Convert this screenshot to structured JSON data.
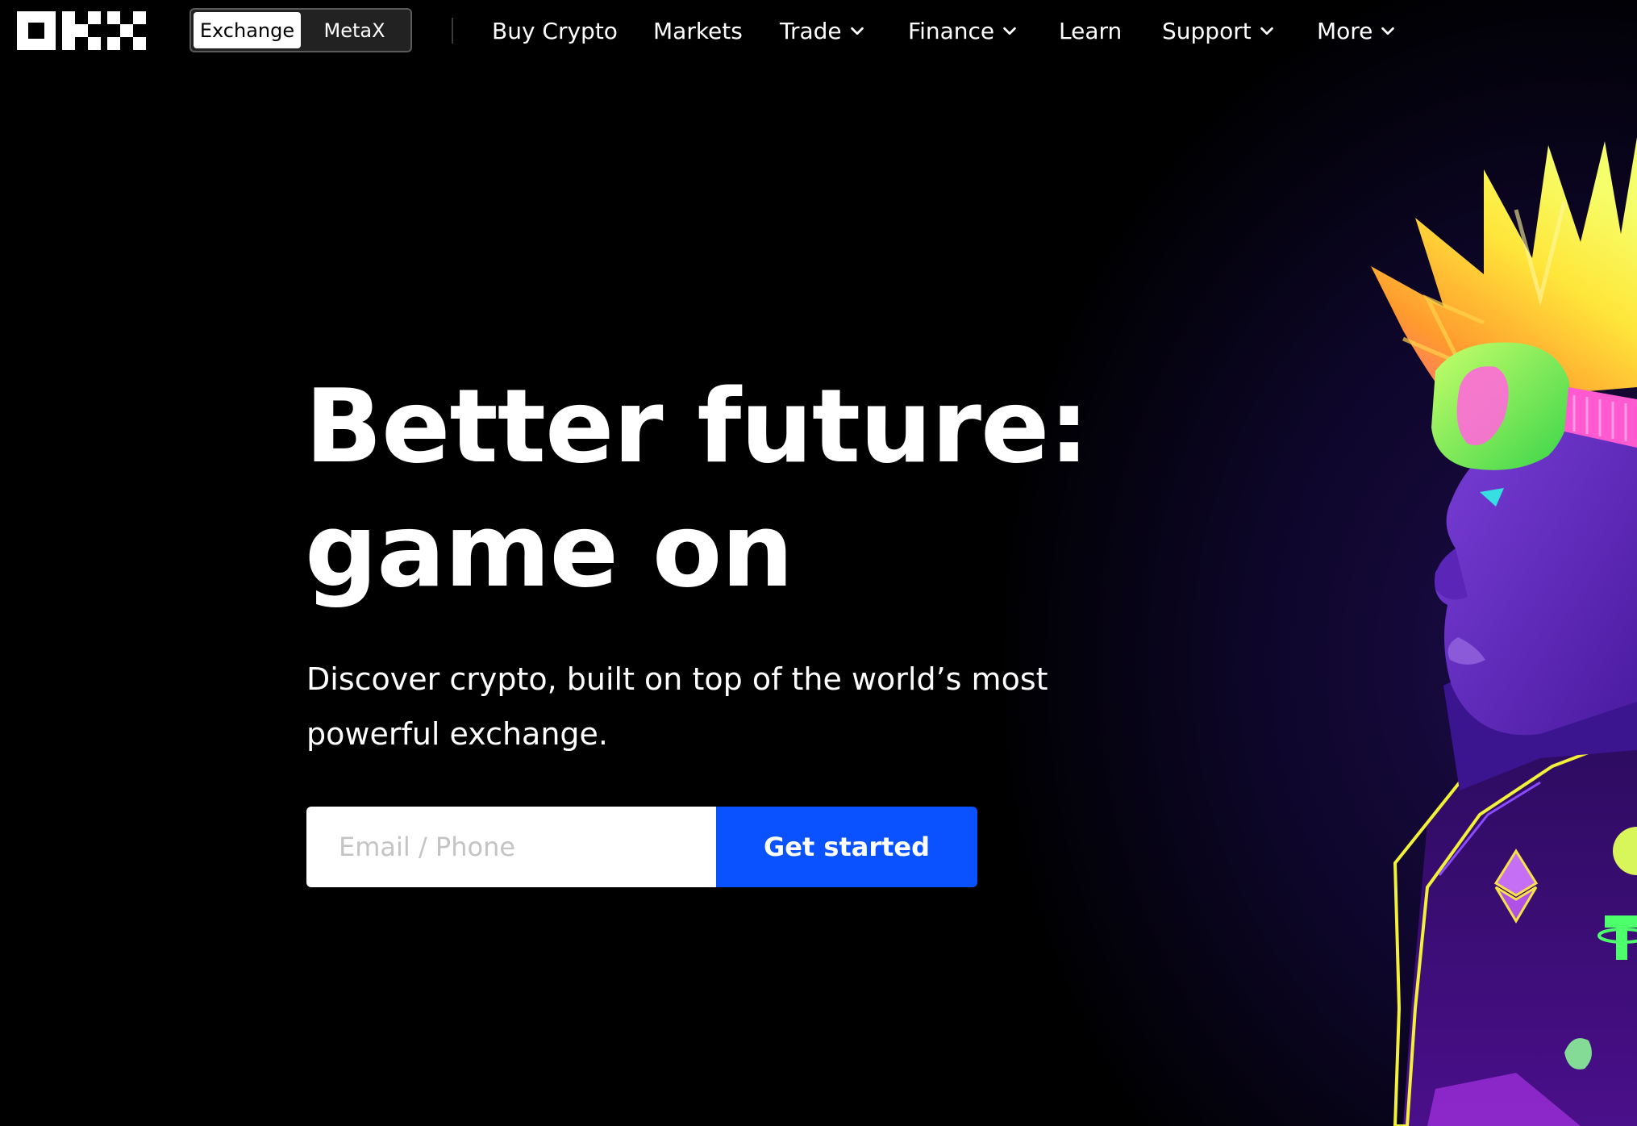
{
  "brand": {
    "logo_text": "OKX"
  },
  "mode_switch": {
    "exchange_label": "Exchange",
    "metax_label": "MetaX",
    "active": "Exchange"
  },
  "nav": {
    "items": [
      {
        "label": "Buy Crypto",
        "dropdown": false
      },
      {
        "label": "Markets",
        "dropdown": false
      },
      {
        "label": "Trade",
        "dropdown": true
      },
      {
        "label": "Finance",
        "dropdown": true
      },
      {
        "label": "Learn",
        "dropdown": false
      },
      {
        "label": "Support",
        "dropdown": true
      },
      {
        "label": "More",
        "dropdown": true
      }
    ]
  },
  "hero": {
    "title_line1": "Better future:",
    "title_line2": "game on",
    "subtitle": "Discover crypto, built on top of the world’s most powerful exchange.",
    "input_placeholder": "Email / Phone",
    "cta_label": "Get started"
  },
  "colors": {
    "background": "#000000",
    "cta_blue": "#0a52ff",
    "text": "#ffffff"
  },
  "icons": {
    "chevron": "chevron-down-icon",
    "illustration_badges": [
      "ethereum-icon",
      "tether-icon",
      "uniswap-icon"
    ]
  }
}
